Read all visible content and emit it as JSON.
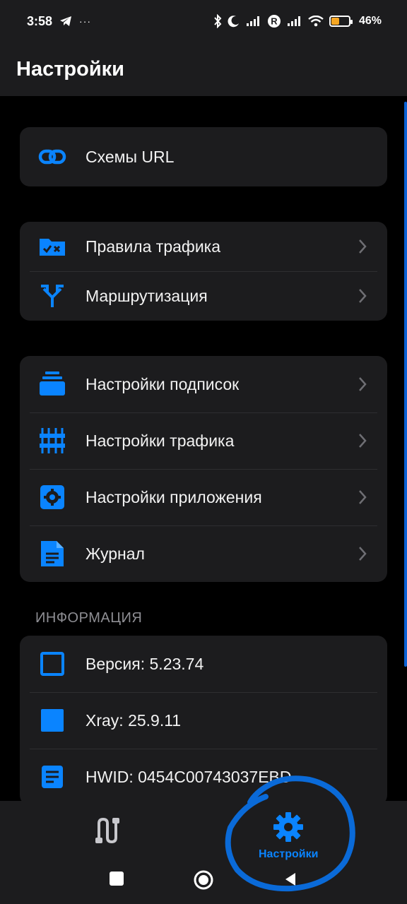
{
  "status_bar": {
    "time": "3:58",
    "ellipsis": "···",
    "battery_percent": "46%",
    "battery_level": 0.46
  },
  "header": {
    "title": "Настройки"
  },
  "groups": {
    "url": {
      "items": [
        {
          "label": "Схемы URL",
          "icon": "link-icon"
        }
      ]
    },
    "routing": {
      "items": [
        {
          "label": "Правила трафика",
          "icon": "folder-rules-icon"
        },
        {
          "label": "Маршрутизация",
          "icon": "route-split-icon"
        }
      ]
    },
    "settings": {
      "items": [
        {
          "label": "Настройки подписок",
          "icon": "subscriptions-icon"
        },
        {
          "label": "Настройки трафика",
          "icon": "sliders-icon"
        },
        {
          "label": "Настройки приложения",
          "icon": "app-gear-icon"
        },
        {
          "label": "Журнал",
          "icon": "document-icon"
        }
      ]
    }
  },
  "info": {
    "section_title": "ИНФОРМАЦИЯ",
    "items": [
      {
        "label": "Версия: 5.23.74",
        "icon": "square-outline-icon"
      },
      {
        "label": "Xray: 25.9.11",
        "icon": "square-filled-icon"
      },
      {
        "label": "HWID: 0454C00743037EBD",
        "icon": "list-doc-icon"
      }
    ]
  },
  "tab_bar": {
    "tabs": [
      {
        "label": "",
        "icon": "connection-icon",
        "active": false
      },
      {
        "label": "Настройки",
        "icon": "gear-icon",
        "active": true
      }
    ]
  },
  "colors": {
    "accent": "#0a84ff",
    "card": "#1c1c1e",
    "background": "#000000",
    "annotation": "#0a6ad8"
  }
}
